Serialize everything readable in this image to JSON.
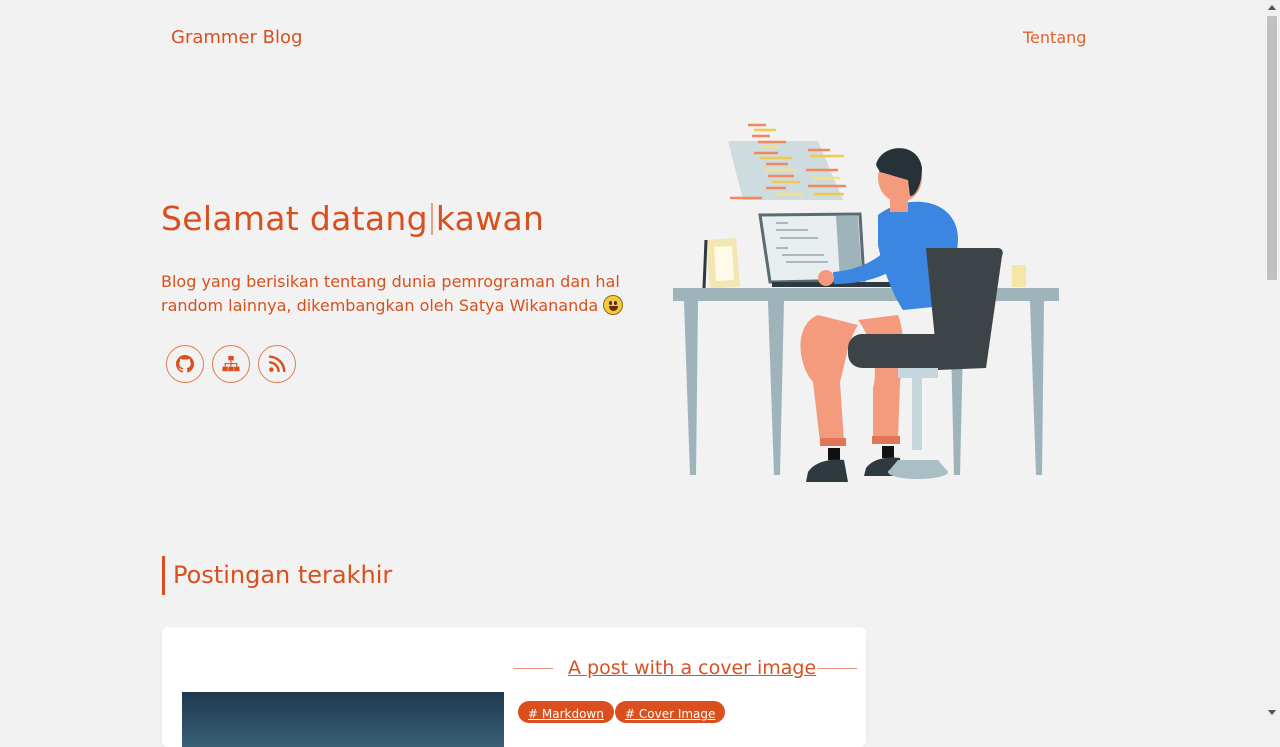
{
  "nav": {
    "brand": "Grammer Blog",
    "about_link": "Tentang"
  },
  "hero": {
    "title_part1": "Selamat datang",
    "title_part2": "kawan",
    "description": "Blog yang berisikan tentang dunia pemrograman dan hal random lainnya, dikembangkan oleh Satya Wikananda ",
    "social_icons": [
      "github-icon",
      "sitemap-icon",
      "rss-icon"
    ]
  },
  "section": {
    "title": "Postingan terakhir"
  },
  "post": {
    "title": "A post with a cover image",
    "tags": [
      "# Markdown",
      "# Cover Image"
    ]
  },
  "colors": {
    "accent": "#d9501e",
    "background": "#f1f2f1",
    "card": "#ffffff"
  }
}
